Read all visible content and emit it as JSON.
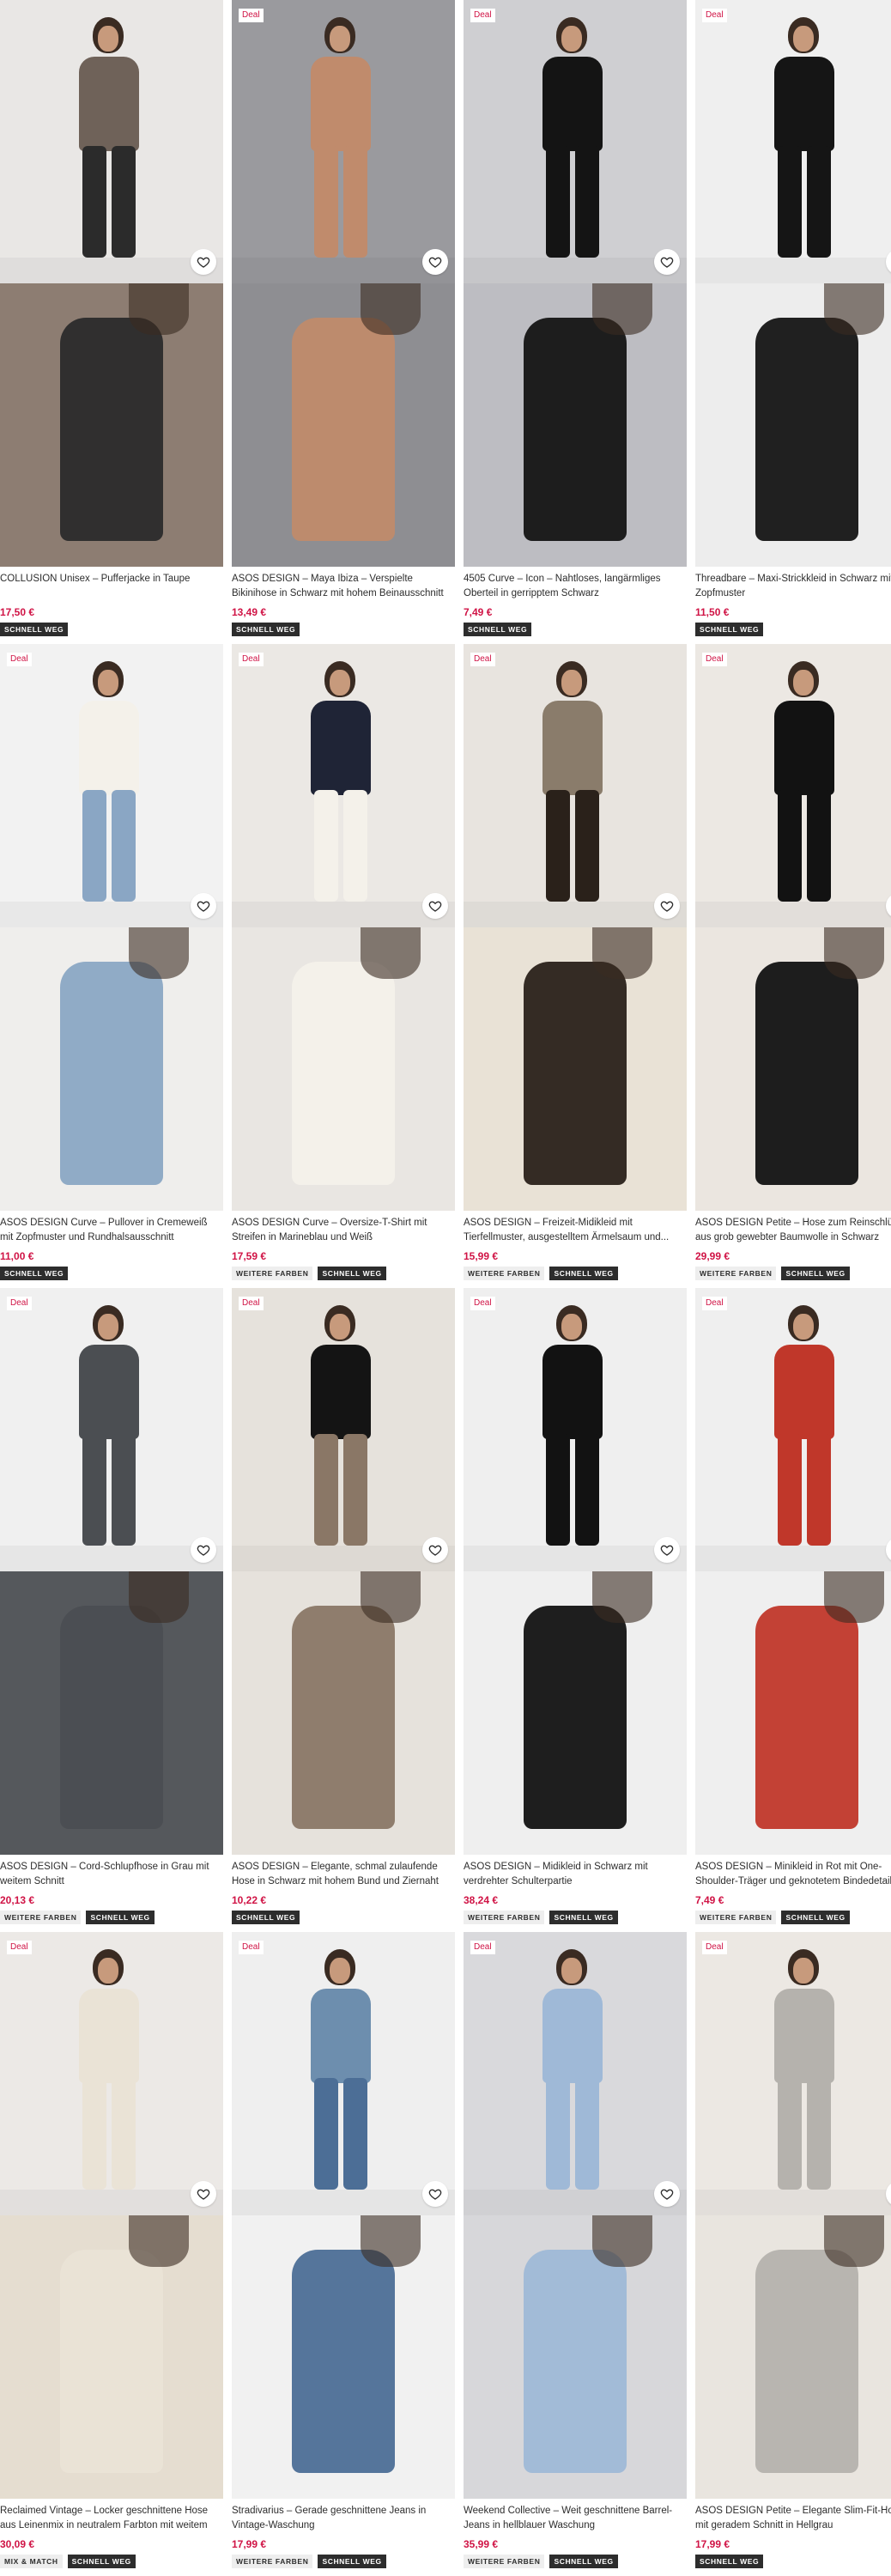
{
  "products": [
    {
      "deal": "",
      "title": "COLLUSION Unisex – Pufferjacke in Taupe",
      "price": "17,50 €",
      "tags": [
        "SCHNELL WEG"
      ],
      "bg": "#e9e7e5",
      "bg2": "#8d7d72",
      "figure": "#6f6259",
      "figure2": "#2b2b2b"
    },
    {
      "deal": "Deal",
      "title": "ASOS DESIGN – Maya Ibiza – Verspielte Bikinihose in Schwarz mit hohem Beinausschnitt",
      "price": "13,49 €",
      "tags": [
        "SCHNELL WEG"
      ],
      "bg": "#9a9a9e",
      "bg2": "#8e8e92",
      "figure": "#c08b6c",
      "figure2": "#c08b6c"
    },
    {
      "deal": "Deal",
      "title": "4505 Curve – Icon – Nahtloses, langärmliges Oberteil in gerripptem Schwarz",
      "price": "7,49 €",
      "tags": [
        "SCHNELL WEG"
      ],
      "bg": "#cfcfd2",
      "bg2": "#bdbdc2",
      "figure": "#141414",
      "figure2": "#141414"
    },
    {
      "deal": "Deal",
      "title": "Threadbare – Maxi-Strickkleid in Schwarz mit Zopfmuster",
      "price": "11,50 €",
      "tags": [
        "SCHNELL WEG"
      ],
      "bg": "#efefef",
      "bg2": "#ededed",
      "figure": "#151515",
      "figure2": "#151515"
    },
    {
      "deal": "Deal",
      "title": "ASOS DESIGN Curve – Pullover in Cremeweiß mit Zopfmuster und Rundhalsausschnitt",
      "price": "11,00 €",
      "tags": [
        "SCHNELL WEG"
      ],
      "bg": "#f2f2f2",
      "bg2": "#efeeec",
      "figure": "#f4f1ea",
      "figure2": "#8aa6c4"
    },
    {
      "deal": "Deal",
      "title": "ASOS DESIGN Curve – Oversize-T-Shirt mit Streifen in Marineblau und Weiß",
      "price": "17,59 €",
      "tags": [
        "WEITERE FARBEN",
        "SCHNELL WEG"
      ],
      "bg": "#ebe8e4",
      "bg2": "#e9e6e2",
      "figure": "#1f2436",
      "figure2": "#f4f1ea"
    },
    {
      "deal": "Deal",
      "title": "ASOS DESIGN – Freizeit-Midikleid mit Tierfellmuster, ausgestelltem Ärmelsaum und...",
      "price": "15,99 €",
      "tags": [
        "WEITERE FARBEN",
        "SCHNELL WEG"
      ],
      "bg": "#e8e4df",
      "bg2": "#e9e2d6",
      "figure": "#8a7c6b",
      "figure2": "#2a211a"
    },
    {
      "deal": "Deal",
      "title": "ASOS DESIGN Petite – Hose zum Reinschlüpfen aus grob gewebter Baumwolle in Schwarz",
      "price": "29,99 €",
      "tags": [
        "WEITERE FARBEN",
        "SCHNELL WEG"
      ],
      "bg": "#ece8e3",
      "bg2": "#ebe6e0",
      "figure": "#121212",
      "figure2": "#121212"
    },
    {
      "deal": "Deal",
      "title": "ASOS DESIGN – Cord-Schlupfhose in Grau mit weitem Schnitt",
      "price": "20,13 €",
      "tags": [
        "WEITERE FARBEN",
        "SCHNELL WEG"
      ],
      "bg": "#f0f0f0",
      "bg2": "#55585c",
      "figure": "#4b4e52",
      "figure2": "#4b4e52"
    },
    {
      "deal": "Deal",
      "title": "ASOS DESIGN – Elegante, schmal zulaufende Hose in Schwarz mit hohem Bund und Ziernaht",
      "price": "10,22 €",
      "tags": [
        "SCHNELL WEG"
      ],
      "bg": "#e6e2dc",
      "bg2": "#e6e2dc",
      "figure": "#141414",
      "figure2": "#8a7766"
    },
    {
      "deal": "Deal",
      "title": "ASOS DESIGN – Midikleid in Schwarz mit verdrehter Schulterpartie",
      "price": "38,24 €",
      "tags": [
        "WEITERE FARBEN",
        "SCHNELL WEG"
      ],
      "bg": "#efefef",
      "bg2": "#efefef",
      "figure": "#121212",
      "figure2": "#121212"
    },
    {
      "deal": "Deal",
      "title": "ASOS DESIGN – Minikleid in Rot mit One-Shoulder-Träger und geknotetem Bindedetail",
      "price": "7,49 €",
      "tags": [
        "WEITERE FARBEN",
        "SCHNELL WEG"
      ],
      "bg": "#efefef",
      "bg2": "#efefef",
      "figure": "#c0372a",
      "figure2": "#c0372a"
    },
    {
      "deal": "Deal",
      "title": "Reclaimed Vintage – Locker geschnittene Hose aus Leinenmix in neutralem Farbton mit weitem Bein",
      "price": "30,09 €",
      "tags": [
        "MIX & MATCH",
        "SCHNELL WEG"
      ],
      "bg": "#ece9e6",
      "bg2": "#e5ddd0",
      "figure": "#eae3d6",
      "figure2": "#eae3d6"
    },
    {
      "deal": "Deal",
      "title": "Stradivarius – Gerade geschnittene Jeans in Vintage-Waschung",
      "price": "17,99 €",
      "tags": [
        "WEITERE FARBEN",
        "SCHNELL WEG"
      ],
      "bg": "#efefef",
      "bg2": "#f1f1f1",
      "figure": "#6d8eae",
      "figure2": "#4c6e96"
    },
    {
      "deal": "Deal",
      "title": "Weekend Collective – Weit geschnittene Barrel-Jeans in hellblauer Waschung",
      "price": "35,99 €",
      "tags": [
        "WEITERE FARBEN",
        "SCHNELL WEG"
      ],
      "bg": "#d9d9dc",
      "bg2": "#d7d7da",
      "figure": "#9fb9d7",
      "figure2": "#9fb9d7"
    },
    {
      "deal": "Deal",
      "title": "ASOS DESIGN Petite – Elegante Slim-Fit-Hose mit geradem Schnitt in Hellgrau",
      "price": "17,99 €",
      "tags": [
        "SCHNELL WEG"
      ],
      "bg": "#ece8e3",
      "bg2": "#e9e5df",
      "figure": "#b5b2ad",
      "figure2": "#b5b2ad"
    }
  ]
}
